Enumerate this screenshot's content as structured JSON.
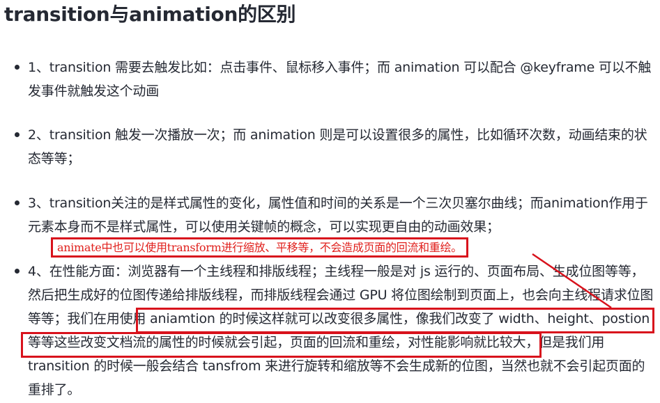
{
  "title": "transition与animation的区别",
  "items": [
    {
      "text": "1、transition 需要去触发比如：点击事件、鼠标移入事件；而 animation 可以配合 @keyframe 可以不触发事件就触发这个动画"
    },
    {
      "text": "2、transition 触发一次播放一次；而 animation 则是可以设置很多的属性，比如循环次数，动画结束的状态等等；"
    },
    {
      "text": "3、transition关注的是样式属性的变化，属性值和时间的关系是一个三次贝塞尔曲线；而animation作用于元素本身而不是样式属性，可以使用关键帧的概念，可以实现更自由的动画效果；"
    },
    {
      "text_before": "4、在性能方面：浏览器有一个主线程和排版线程；主线程一般是对 js 运行的、页面布局、生成位图等等，然后把生成好的位图传递给排版线程，而排版线程会通过 GPU 将位图绘制到页面上，也会向主线程请求位图等等；",
      "text_highlight": "我们在用使用 aniamtion 的时候这样就可以改变很多属性，像我们改变了 width、height、postion 等等这些改变文档流的属性的时候就会引起，页面的回流和重绘，",
      "text_after": "对性能影响就比较大，但是我们用 transition 的时候一般会结合 tansfrom 来进行旋转和缩放等不会生成新的位图，当然也就不会引起页面的重排了。"
    }
  ],
  "annotation": {
    "text": "animate中也可以使用transform进行缩放、平移等，不会造成页面的回流和重绘。",
    "color": "#e0201c",
    "border_color": "#d8121c"
  }
}
